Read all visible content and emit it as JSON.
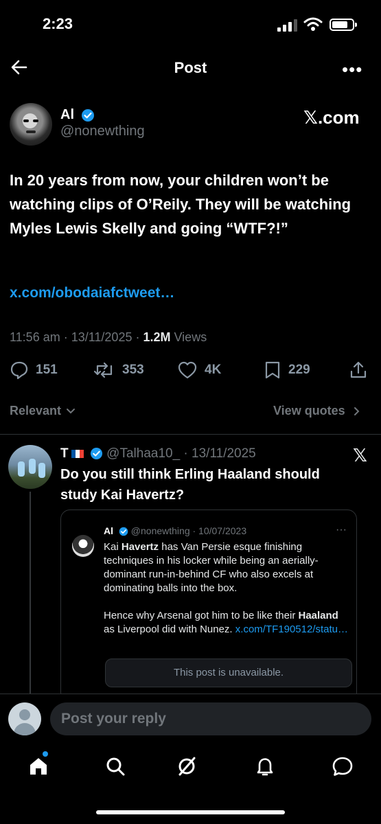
{
  "status_bar": {
    "time": "2:23"
  },
  "nav": {
    "title": "Post",
    "back_icon": "arrow-left-icon",
    "more_icon": "more-horizontal-icon",
    "more_label": "•••"
  },
  "post": {
    "author_name": "Al",
    "author_handle": "@nonewthing",
    "source_badge": "𝕏.com",
    "text": "In 20 years from now, your children won’t be watching clips of O’Reily. They will be watching Myles Lewis Skelly and going “WTF?!”",
    "link": "x.com/obodaiafctweet…",
    "time": "11:56 am · 13/11/2025 · ",
    "views_count": "1.2M",
    "views_label": " Views",
    "actions": {
      "replies": "151",
      "reposts": "353",
      "likes": "4K",
      "bookmarks": "229"
    }
  },
  "filters": {
    "sort_label": "Relevant",
    "view_quotes": "View quotes"
  },
  "reply": {
    "author_name": "T",
    "author_handle": "@Talhaa10_",
    "date": " · 13/11/2025",
    "source_icon": "𝕏",
    "text": "Do you still think Erling Haaland should study Kai Havertz?",
    "quote": {
      "author_name": "Al",
      "author_handle": "@nonewthing",
      "date": " · 10/07/2023",
      "dots": "···",
      "para1_pre": "Kai ",
      "para1_bold": "Havertz",
      "para1_post": " has Van Persie esque finishing techniques in his locker while being an aerially-dominant run-in-behind CF who also excels at dominating balls into the box.",
      "para2_pre": "Hence why Arsenal got him to be like their ",
      "para2_bold": "Haaland",
      "para2_post": " as Liverpool did with Nunez. ",
      "para2_link": "x.com/TF190512/statu…",
      "unavailable": "This post is unavailable."
    }
  },
  "compose": {
    "placeholder": "Post your reply"
  },
  "tabbar": [
    "home-icon",
    "search-icon",
    "grok-icon",
    "notifications-icon",
    "messages-icon"
  ],
  "colors": {
    "accent": "#1d9bf0",
    "background": "#000000",
    "muted": "#71767b"
  }
}
